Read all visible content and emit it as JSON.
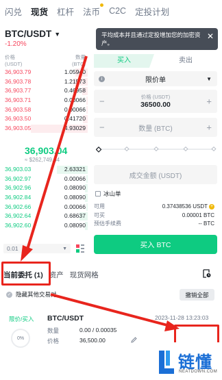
{
  "top_tabs": [
    {
      "label": "闪兑"
    },
    {
      "label": "现货"
    },
    {
      "label": "杠杆"
    },
    {
      "label": "法币"
    },
    {
      "label": "C2C"
    },
    {
      "label": "定投计划"
    }
  ],
  "pair": {
    "symbol": "BTC/USDT",
    "change": "-1.20%"
  },
  "orderbook": {
    "price_header": "价格\n(USDT)",
    "qty_header": "数量\n(BTC)",
    "asks": [
      {
        "price": "36,903.79",
        "qty": "1.05940",
        "depth": 0.15
      },
      {
        "price": "36,903.78",
        "qty": "1.21573",
        "depth": 0.18
      },
      {
        "price": "36,903.77",
        "qty": "0.46958",
        "depth": 0.07
      },
      {
        "price": "36,903.71",
        "qty": "0.00066",
        "depth": 0.02
      },
      {
        "price": "36,903.58",
        "qty": "0.00066",
        "depth": 0.02
      },
      {
        "price": "36,903.50",
        "qty": "0.41720",
        "depth": 0.06
      },
      {
        "price": "36,903.05",
        "qty": "4.93029",
        "depth": 0.7
      }
    ],
    "last_price": "36,903.04",
    "last_price_usd": "≈ $262,749.64",
    "bids": [
      {
        "price": "36,903.03",
        "qty": "2.63321",
        "depth": 0.38
      },
      {
        "price": "36,902.97",
        "qty": "0.00066",
        "depth": 0.02
      },
      {
        "price": "36,902.96",
        "qty": "0.08090",
        "depth": 0.03
      },
      {
        "price": "36,902.84",
        "qty": "0.08090",
        "depth": 0.03
      },
      {
        "price": "36,902.66",
        "qty": "0.00066",
        "depth": 0.02
      },
      {
        "price": "36,902.64",
        "qty": "0.68637",
        "depth": 0.1
      },
      {
        "price": "36,902.60",
        "qty": "0.08090",
        "depth": 0.03
      }
    ],
    "depth_step": "0.01"
  },
  "tooltip": "平均成本并且通过定投增加您的加密资产。",
  "trade_panel": {
    "buy_tab": "买入",
    "sell_tab": "卖出",
    "order_type": "限价单",
    "price_label": "价格 (USDT)",
    "price_value": "36500.00",
    "qty_placeholder": "数量 (BTC)",
    "total_placeholder": "成交金额 (USDT)",
    "iceberg_label": "冰山单",
    "available_label": "可用",
    "available_value": "0.37438536 USDT",
    "can_buy_label": "可买",
    "can_buy_value": "0.00001 BTC",
    "fee_label": "预估手续费",
    "fee_value": "-- BTC",
    "buy_button": "买入 BTC"
  },
  "bottom_tabs": [
    {
      "label": "当前委托 (1)"
    },
    {
      "label": "资产"
    },
    {
      "label": "现货网格"
    }
  ],
  "hide_other_pairs": "隐藏其他交易对",
  "cancel_all": "撤销全部",
  "open_order": {
    "side": "限价/买入",
    "filled_pct": "0%",
    "symbol": "BTC/USDT",
    "time": "2023-11-28 13:23:03",
    "qty_label": "数量",
    "qty_value": "0.00 / 0.00035",
    "price_label": "价格",
    "price_value": "36,500.00"
  },
  "watermark": {
    "text": "链懂",
    "sub": "NEATDOWN.COM"
  },
  "colors": {
    "buy": "#0ecb81",
    "sell": "#f6465d",
    "accent": "#f0b90b",
    "annotation": "#e8251d",
    "watermark": "#1b6fd6"
  }
}
